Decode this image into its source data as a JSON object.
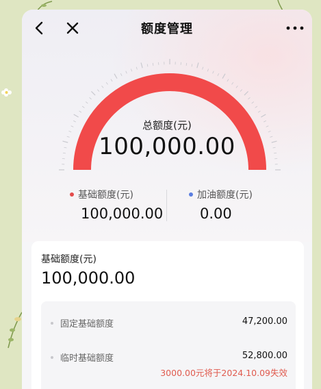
{
  "nav": {
    "title": "额度管理"
  },
  "gauge": {
    "total_label": "总额度(元)",
    "total_value": "100,000.00",
    "fill_fraction": 1.0,
    "arc_color": "#f14a4a",
    "track_color": "#ffd8d4"
  },
  "split": {
    "base": {
      "label": "基础额度(元)",
      "value": "100,000.00",
      "dot_color": "#e34b4b"
    },
    "boost": {
      "label": "加油额度(元)",
      "value": "0.00",
      "dot_color": "#5b7ee0"
    }
  },
  "card": {
    "title": "基础额度(元)",
    "value": "100,000.00",
    "rows": [
      {
        "name": "固定基础额度",
        "amount": "47,200.00"
      },
      {
        "name": "临时基础额度",
        "amount": "52,800.00",
        "note": "3000.00元将于2024.10.09失效"
      }
    ]
  },
  "icons": {
    "back": "chevron-left-icon",
    "close": "close-icon",
    "more": "more-horizontal-icon"
  }
}
